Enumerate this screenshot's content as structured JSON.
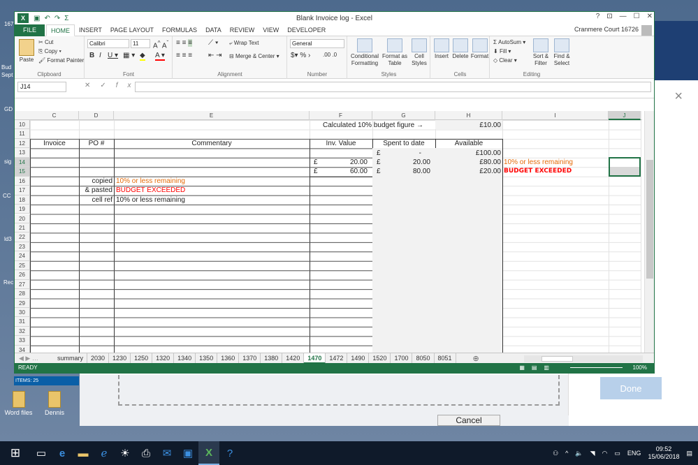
{
  "desktop": {
    "icons": [
      {
        "label": "Word files"
      },
      {
        "label": "Dennis"
      }
    ],
    "left_labels": [
      "167",
      "Bud",
      "Sept",
      "GD",
      "sig",
      "CC",
      "ld3",
      "Rec"
    ]
  },
  "background": {
    "done_label": "Done",
    "cancel_label": "Cancel",
    "close_symbol": "×",
    "items_label": "ITEMS: 25"
  },
  "excel": {
    "title": "Blank Invoice log - Excel",
    "tabs": [
      "FILE",
      "HOME",
      "INSERT",
      "PAGE LAYOUT",
      "FORMULAS",
      "DATA",
      "REVIEW",
      "VIEW",
      "DEVELOPER"
    ],
    "user": "Cranmere Court 16726",
    "ribbon": {
      "clipboard": {
        "paste": "Paste",
        "cut": "Cut",
        "copy": "Copy",
        "format_painter": "Format Painter",
        "label": "Clipboard"
      },
      "font": {
        "name": "Calibri",
        "size": "11",
        "label": "Font"
      },
      "alignment": {
        "wrap": "Wrap Text",
        "merge": "Merge & Center",
        "label": "Alignment"
      },
      "number": {
        "format": "General",
        "label": "Number"
      },
      "styles": {
        "cond": "Conditional Formatting",
        "table": "Format as Table",
        "cell": "Cell Styles",
        "label": "Styles"
      },
      "cells": {
        "insert": "Insert",
        "delete": "Delete",
        "format": "Format",
        "label": "Cells"
      },
      "editing": {
        "autosum": "AutoSum",
        "fill": "Fill",
        "clear": "Clear",
        "sort": "Sort & Filter",
        "find": "Find & Select",
        "label": "Editing"
      }
    },
    "name_box": "J14",
    "columns": [
      "C",
      "D",
      "E",
      "F",
      "G",
      "H",
      "I",
      "J"
    ],
    "rows": [
      "10",
      "11",
      "12",
      "13",
      "14",
      "15",
      "16",
      "17",
      "18",
      "19",
      "20",
      "21",
      "22",
      "23",
      "24",
      "25",
      "26",
      "27",
      "28",
      "29",
      "30",
      "31",
      "32",
      "33",
      "34"
    ],
    "cells": {
      "calc_label": "Calculated 10% budget figure →",
      "calc_value": "£10.00",
      "hdr_invoice": "Invoice",
      "hdr_po": "PO #",
      "hdr_commentary": "Commentary",
      "hdr_inv_value": "Inv. Value",
      "hdr_spent": "Spent to date",
      "hdr_available": "Available",
      "r13_g_cur": "£",
      "r13_g_val": "-",
      "r13_h": "£100.00",
      "r14_f_cur": "£",
      "r14_f_val": "20.00",
      "r14_g_cur": "£",
      "r14_g_val": "20.00",
      "r14_h": "£80.00",
      "r14_i": "10% or less remaining",
      "r15_f_cur": "£",
      "r15_f_val": "60.00",
      "r15_g_cur": "£",
      "r15_g_val": "80.00",
      "r15_h": "£20.00",
      "r15_i": "BUDGET EXCEEDED",
      "r16_d": "copied",
      "r16_e": "10% or less remaining",
      "r17_d": "& pasted",
      "r17_e": "BUDGET EXCEEDED",
      "r18_d": "cell ref",
      "r18_e": "10% or less remaining"
    },
    "sheets": [
      "summary",
      "2030",
      "1230",
      "1250",
      "1320",
      "1340",
      "1350",
      "1360",
      "1370",
      "1380",
      "1420",
      "1470",
      "1472",
      "1490",
      "1520",
      "1700",
      "8050",
      "8051"
    ],
    "active_sheet": "1470",
    "status": "READY",
    "zoom": "100%"
  },
  "taskbar": {
    "lang": "ENG",
    "time": "09:52",
    "date": "15/06/2018"
  }
}
